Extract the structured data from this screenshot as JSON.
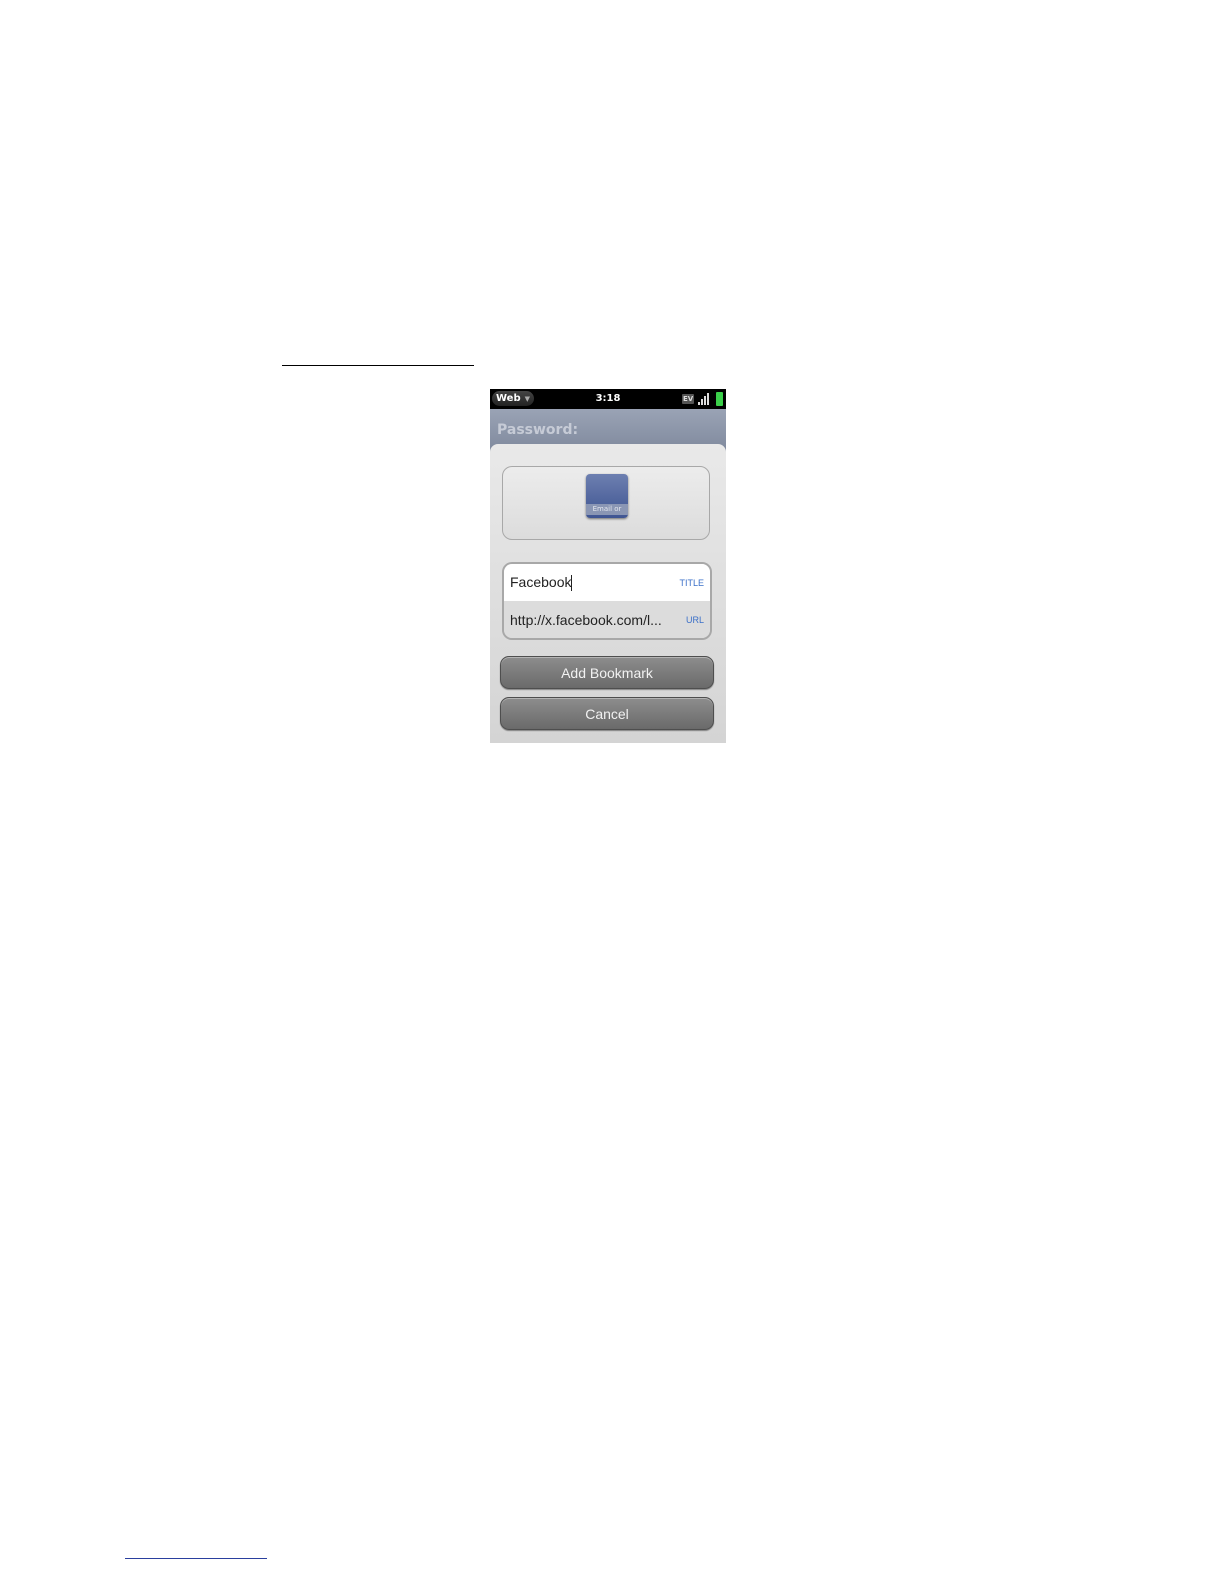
{
  "status_bar": {
    "app_name": "Web",
    "time": "3:18",
    "network_label": "EV"
  },
  "background_page": {
    "label": "Password:"
  },
  "bookmark_dialog": {
    "thumbnail_label": "Email or",
    "title_field": {
      "value": "Facebook",
      "tag": "TITLE"
    },
    "url_field": {
      "value": "http://x.facebook.com/l...",
      "tag": "URL"
    },
    "add_button_label": "Add Bookmark",
    "cancel_button_label": "Cancel"
  },
  "colors": {
    "field_tag": "#3a6fc8",
    "button": "#7a7a7a",
    "battery": "#3bd04a"
  }
}
